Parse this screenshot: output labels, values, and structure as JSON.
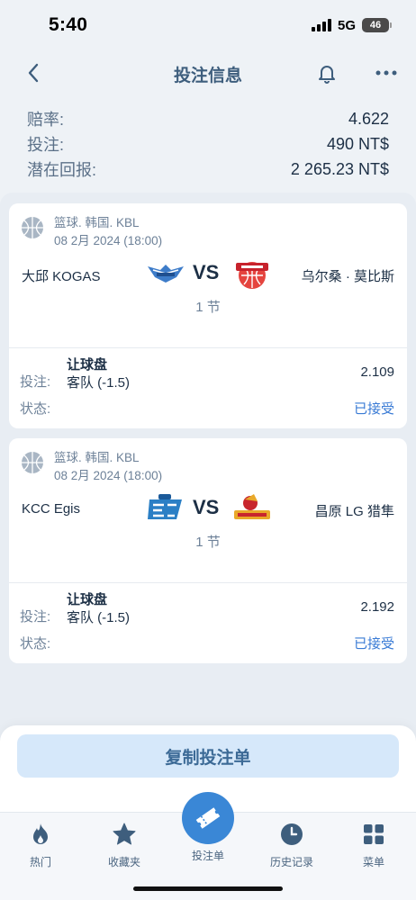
{
  "status_bar": {
    "time": "5:40",
    "network": "5G",
    "battery": "46"
  },
  "header": {
    "title": "投注信息"
  },
  "summary": [
    {
      "label": "赔率:",
      "value": "4.622"
    },
    {
      "label": "投注:",
      "value": "490 NT$"
    },
    {
      "label": "潜在回报:",
      "value": "2 265.23 NT$"
    }
  ],
  "bets": [
    {
      "league": "篮球. 韩国. KBL",
      "date": "08 2月 2024 (18:00)",
      "home": "大邱 KOGAS",
      "vs": "VS",
      "away": "乌尔桑 · 莫比斯",
      "period": "1 节",
      "bet_label": "投注:",
      "market": "让球盘",
      "selection": "客队 (-1.5)",
      "odds": "2.109",
      "status_label": "状态:",
      "status": "已接受"
    },
    {
      "league": "篮球. 韩国. KBL",
      "date": "08 2月 2024 (18:00)",
      "home": "KCC Egis",
      "vs": "VS",
      "away": "昌原 LG 猎隼",
      "period": "1 节",
      "bet_label": "投注:",
      "market": "让球盘",
      "selection": "客队 (-1.5)",
      "odds": "2.192",
      "status_label": "状态:",
      "status": "已接受"
    }
  ],
  "copy_button": "复制投注单",
  "tabs": [
    {
      "label": "热门",
      "icon": "flame-icon"
    },
    {
      "label": "收藏夹",
      "icon": "star-icon"
    },
    {
      "label": "投注单",
      "icon": "ticket-icon"
    },
    {
      "label": "历史记录",
      "icon": "clock-icon"
    },
    {
      "label": "菜单",
      "icon": "grid-icon"
    }
  ],
  "colors": {
    "accent": "#3a87d6",
    "status_ok": "#3a7bd5",
    "title": "#3e5e7d",
    "button_bg": "#d6e8fa"
  }
}
